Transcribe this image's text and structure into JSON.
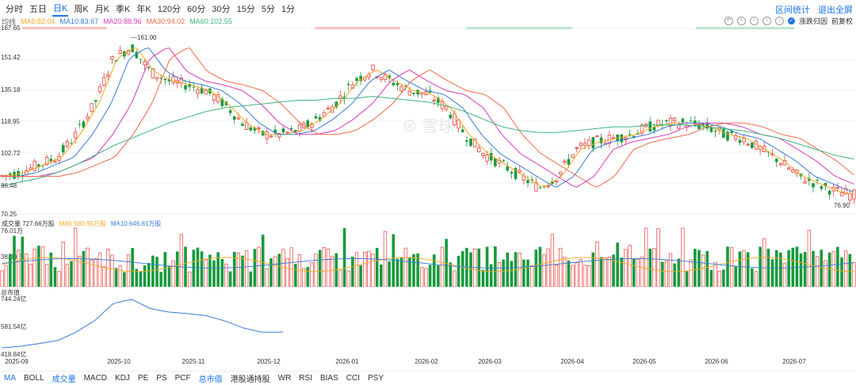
{
  "periods": [
    "分时",
    "五日",
    "日K",
    "周K",
    "月K",
    "季K",
    "年K",
    "120分",
    "60分",
    "30分",
    "15分",
    "5分",
    "1分"
  ],
  "active_period": "日K",
  "top_links": {
    "range_stats": "区间统计",
    "exit_fullscreen": "退出全屏"
  },
  "ma": {
    "label": "均线",
    "ma5": "MA5:82.04",
    "ma10": "MA10:83.67",
    "ma20": "MA20:88.96",
    "ma30": "MA30:94.02",
    "ma60": "MA60:102.55",
    "colors": {
      "ma5": "#f5a623",
      "ma10": "#3a7bd5",
      "ma20": "#d53bb8",
      "ma30": "#f06a4a",
      "ma60": "#3fb37f"
    }
  },
  "tools": {
    "toggle_label": "涨跌归因",
    "adjust_label": "前复权"
  },
  "price_axis": [
    "167.65",
    "151.42",
    "135.18",
    "118.95",
    "102.72",
    "86.48",
    "70.25"
  ],
  "price_high_label": "161.00",
  "price_low_label": "76.90",
  "watermark": "雪球",
  "volume": {
    "label": "成交量 727.66万股",
    "ma5": "MA5:580.95万股",
    "ma10": "MA10:646.81万股",
    "axis_top": "76.01万",
    "axis_mid": "38.00万"
  },
  "mcap": {
    "label": "总市值",
    "axis_top": "744.24亿",
    "axis_mid": "581.54亿",
    "axis_bottom": "418.84亿"
  },
  "x_labels": [
    "2025-09",
    "2025-10",
    "2025-11",
    "2025-12",
    "2026-01",
    "2026-02",
    "2026-03",
    "2026-04",
    "2026-05",
    "2026-06",
    "2026-07"
  ],
  "indicators": [
    "MA",
    "BOLL",
    "成交量",
    "MACD",
    "KDJ",
    "PE",
    "PS",
    "PCF",
    "总市值",
    "港股通持股",
    "WR",
    "RSI",
    "BIAS",
    "CCI",
    "PSY"
  ],
  "active_indicators": [
    "MA",
    "成交量",
    "总市值"
  ],
  "colors": {
    "up": "#e8403a",
    "down": "#179a3b",
    "accent": "#1a73e8"
  },
  "chart_data": {
    "type": "line",
    "title": "",
    "y_range": [
      70.25,
      167.65
    ],
    "x_ticks": [
      "2025-09",
      "2025-10",
      "2025-11",
      "2025-12",
      "2026-01",
      "2026-02",
      "2026-03",
      "2026-04",
      "2026-05",
      "2026-06",
      "2026-07"
    ],
    "series": [
      {
        "name": "MA5",
        "y": [
          90,
          92,
          96,
          100,
          112,
          128,
          152,
          158,
          145,
          140,
          138,
          135,
          128,
          118,
          112,
          112,
          114,
          120,
          128,
          140,
          146,
          140,
          135,
          133,
          126,
          112,
          102,
          96,
          90,
          84,
          90,
          104,
          108,
          110,
          112,
          116,
          118,
          118,
          116,
          112,
          110,
          104,
          98,
          90,
          86,
          82,
          80
        ]
      },
      {
        "name": "MA60",
        "y": [
          85,
          87,
          89,
          92,
          96,
          101,
          106,
          110,
          114,
          118,
          121,
          124,
          126,
          127,
          128,
          129,
          130,
          130,
          131,
          131,
          132,
          131,
          130,
          129,
          127,
          124,
          120,
          116,
          114,
          113,
          113,
          114,
          115,
          116,
          116,
          117,
          117,
          117,
          116,
          115,
          114,
          112,
          110,
          107,
          104,
          101,
          99
        ]
      }
    ]
  }
}
